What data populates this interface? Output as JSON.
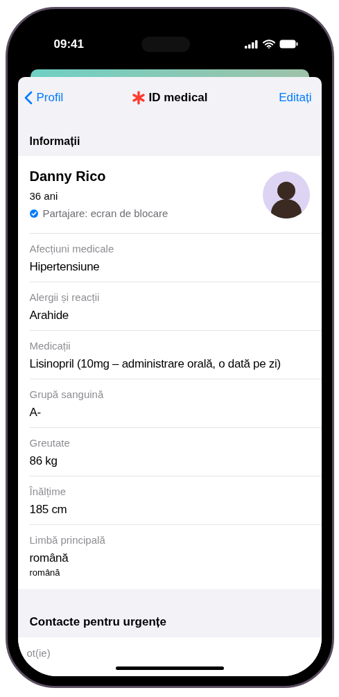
{
  "status_bar": {
    "time": "09:41"
  },
  "nav": {
    "back_label": "Profil",
    "title": "ID medical",
    "action": "Editați"
  },
  "info_section": {
    "title": "Informații"
  },
  "profile": {
    "name": "Danny Rico",
    "age": "36 ani",
    "sharing": "Partajare: ecran de blocare"
  },
  "fields": [
    {
      "label": "Afecțiuni medicale",
      "value": "Hipertensiune"
    },
    {
      "label": "Alergii și reacții",
      "value": "Arahide"
    },
    {
      "label": "Medicații",
      "value": "Lisinopril (10mg – administrare orală, o dată pe zi)"
    },
    {
      "label": "Grupă sanguină",
      "value": "A-"
    },
    {
      "label": "Greutate",
      "value": "86 kg"
    },
    {
      "label": "Înălțime",
      "value": "185 cm"
    },
    {
      "label": "Limbă principală",
      "value": "română",
      "subvalue": "română"
    }
  ],
  "emergency_section": {
    "title": "Contacte pentru urgențe",
    "partial_row": "ot(ie)"
  }
}
